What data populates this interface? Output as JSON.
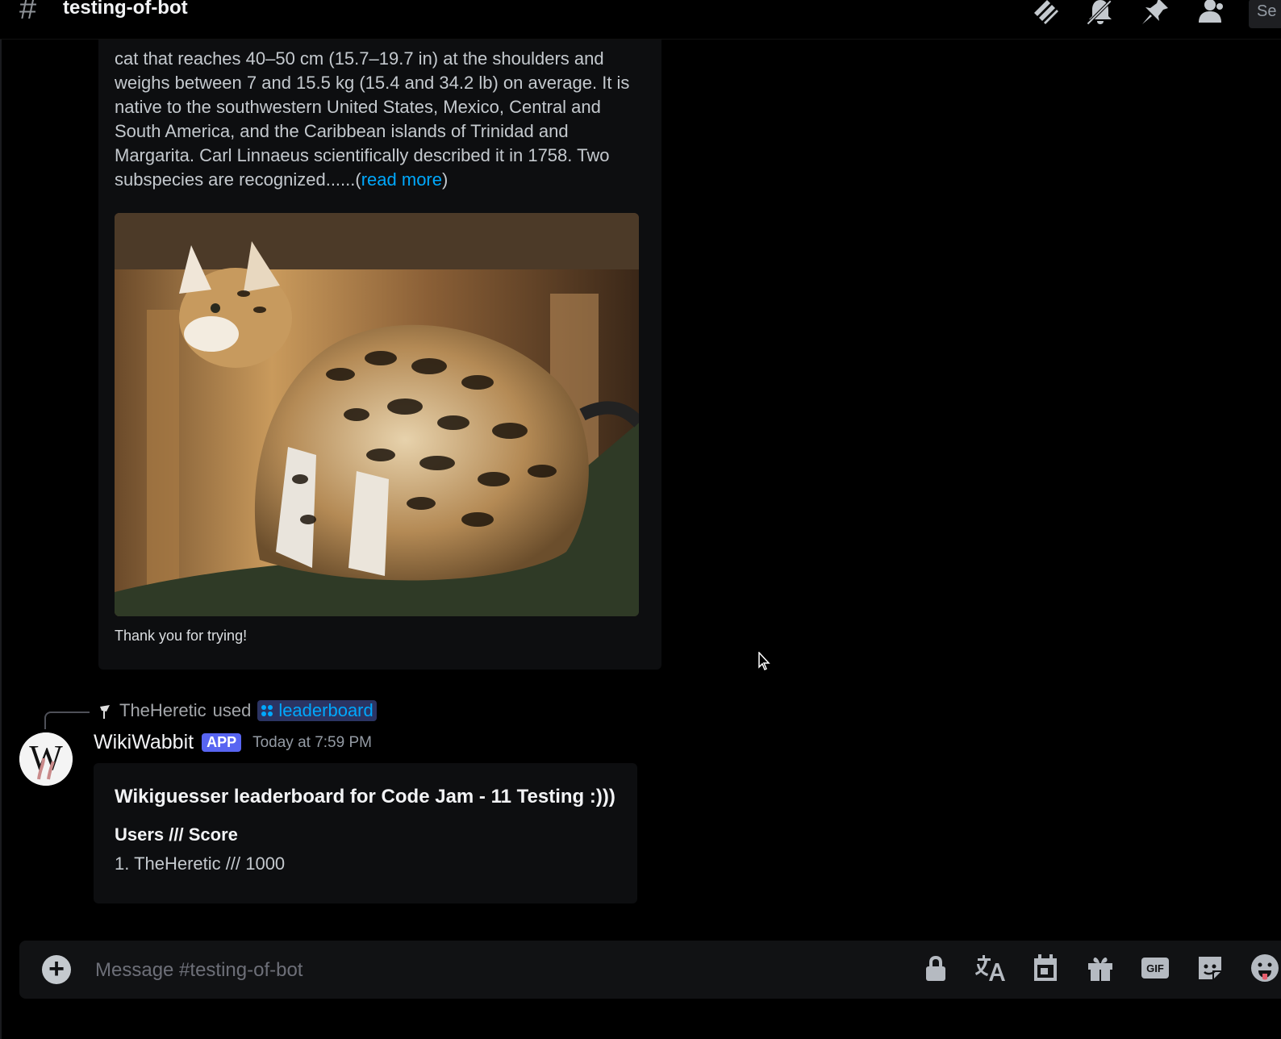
{
  "header": {
    "channel_name": "testing-of-bot",
    "search_stub": "Se"
  },
  "embed1": {
    "text_partial": "cat that reaches 40–50 cm (15.7–19.7 in) at the shoulders and weighs between 7 and 15.5 kg (15.4 and 34.2 lb) on average. It is native to the southwestern United States, Mexico, Central and South America, and the Caribbean islands of Trinidad and Margarita. Carl Linnaeus scientifically described it in 1758. Two subspecies are recognized......(",
    "read_more": "read more",
    "close_paren": ")",
    "footer_text": "Thank you for trying!"
  },
  "message": {
    "reply_user": "TheHeretic",
    "reply_used": "used",
    "reply_command": "leaderboard",
    "author": "WikiWabbit",
    "badge": "APP",
    "timestamp": "Today at 7:59 PM",
    "embed": {
      "title": "Wikiguesser leaderboard for Code Jam - 11 Testing :)))",
      "field_name": "Users /// Score",
      "field_value": "1. TheHeretic /// 1000"
    }
  },
  "composer": {
    "placeholder": "Message #testing-of-bot"
  },
  "colors": {
    "link": "#00a8fc",
    "app_badge": "#5865f2",
    "background": "#000000"
  },
  "icons": [
    "threads-icon",
    "mute-icon",
    "pin-icon",
    "members-icon",
    "lock-icon",
    "translate-icon",
    "calendar-icon",
    "gift-icon",
    "gif-icon",
    "sticker-icon",
    "emoji-icon"
  ]
}
